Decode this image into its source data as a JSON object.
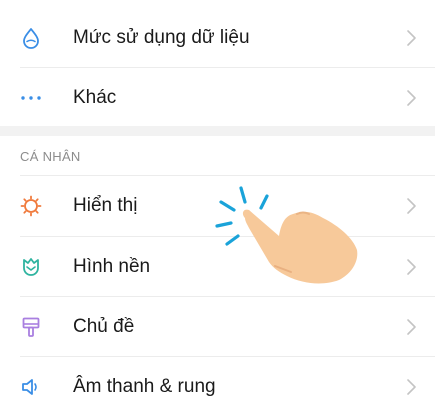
{
  "settings": {
    "items_top": [
      {
        "label": "Mức sử dụng dữ liệu",
        "icon": "water-drop-icon"
      },
      {
        "label": "Khác",
        "icon": "more-horizontal-icon"
      }
    ],
    "section_header": "CÁ NHÂN",
    "items_personal": [
      {
        "label": "Hiển thị",
        "icon": "brightness-icon"
      },
      {
        "label": "Hình nền",
        "icon": "wallpaper-tulip-icon"
      },
      {
        "label": "Chủ đề",
        "icon": "paint-brush-icon"
      },
      {
        "label": "Âm thanh & rung",
        "icon": "speaker-icon"
      }
    ]
  },
  "colors": {
    "icon_blue": "#3a8ee6",
    "icon_orange": "#f07a3c",
    "icon_teal": "#2fb4a0",
    "icon_purple": "#a97fe0",
    "tap_blue": "#1aa3d9",
    "hand_skin": "#f7c99a"
  }
}
